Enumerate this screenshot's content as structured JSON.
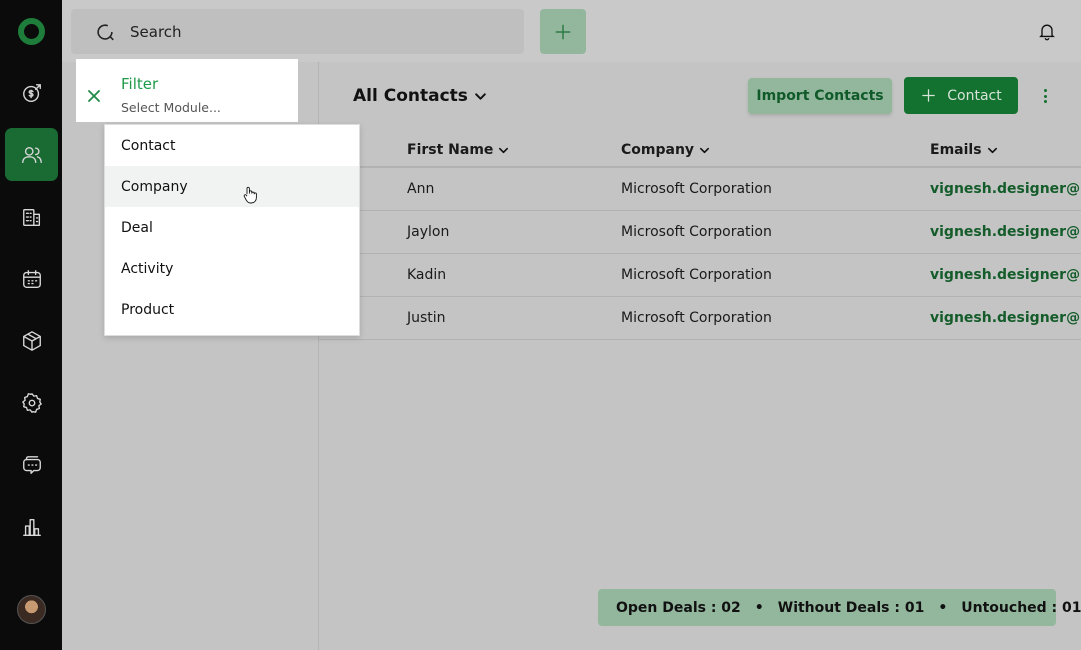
{
  "search": {
    "placeholder": "Search"
  },
  "sidebar": {
    "items": [
      {
        "icon": "deals-icon",
        "active": false
      },
      {
        "icon": "contacts-icon",
        "active": true
      },
      {
        "icon": "companies-icon",
        "active": false
      },
      {
        "icon": "calendar-icon",
        "active": false
      },
      {
        "icon": "products-icon",
        "active": false
      },
      {
        "icon": "settings-icon",
        "active": false
      },
      {
        "icon": "chat-icon",
        "active": false
      },
      {
        "icon": "reports-icon",
        "active": false
      }
    ]
  },
  "header": {
    "list_title": "All Contacts",
    "import_label": "Import Contacts",
    "contact_label": "Contact"
  },
  "table": {
    "columns": [
      "First Name",
      "Company",
      "Emails"
    ],
    "rows": [
      {
        "first_name": "Ann",
        "company": "Microsoft Corporation",
        "email": "vignesh.designer@mc"
      },
      {
        "first_name": "Jaylon",
        "company": "Microsoft Corporation",
        "email": "vignesh.designer@mc"
      },
      {
        "first_name": "Kadin",
        "company": "Microsoft Corporation",
        "email": "vignesh.designer@mc"
      },
      {
        "first_name": "Justin",
        "company": "Microsoft Corporation",
        "email": "vignesh.designer@mc"
      }
    ]
  },
  "stats": {
    "open_deals": "Open Deals : 02",
    "without_deals": "Without Deals : 01",
    "untouched": "Untouched : 01",
    "separator": "•"
  },
  "filter": {
    "title": "Filter",
    "placeholder": "Select Module...",
    "options": [
      "Contact",
      "Company",
      "Deal",
      "Activity",
      "Product"
    ],
    "hovered": "Company"
  },
  "colors": {
    "accent": "#13722f",
    "accent_light": "#93b79d",
    "sidebar_bg": "#0b0b0b",
    "email": "#145c2a"
  }
}
